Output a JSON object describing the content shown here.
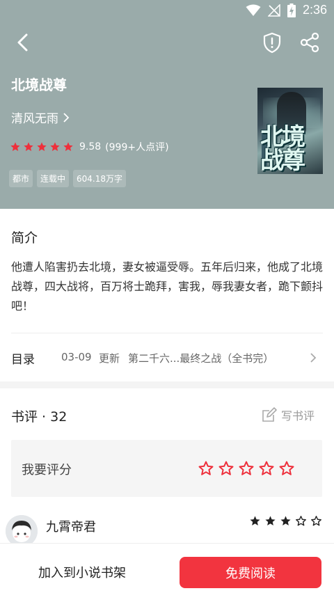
{
  "status_bar": {
    "time": "2:36"
  },
  "book": {
    "title": "北境战尊",
    "author": "清风无雨",
    "rating_score": "9.58",
    "rating_count": "(999+人点评)",
    "rating_stars": 5,
    "tags": [
      "都市",
      "连载中",
      "604.18万字"
    ],
    "cover_title": "北境战尊"
  },
  "intro": {
    "heading": "简介",
    "text": "他遭人陷害扔去北境，妻女被逼受辱。五年后归来，他成了北境战尊，四大战将，百万将士跪拜，害我，辱我妻女者，跪下颤抖吧！"
  },
  "toc": {
    "label": "目录",
    "date": "03-09",
    "update": "更新",
    "chapter": "第二千六...最终之战（全书完）"
  },
  "reviews": {
    "heading": "书评 · 32",
    "write_label": "写书评",
    "rate_label": "我要评分",
    "comments": [
      {
        "user": "九霄帝君",
        "stars": 3
      }
    ]
  },
  "bottom": {
    "add_shelf": "加入到小说书架",
    "read": "免费阅读"
  },
  "colors": {
    "header_bg": "#9aabaa",
    "accent_red": "#f2343f",
    "star_red": "#ee2f3b"
  }
}
